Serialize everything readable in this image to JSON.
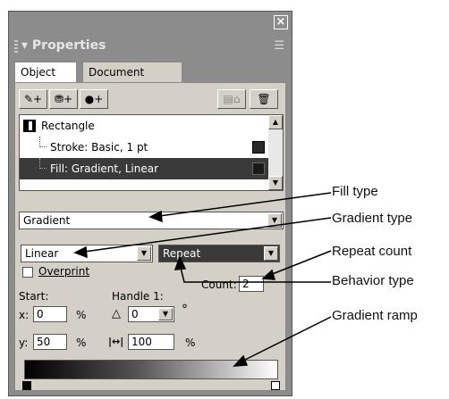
{
  "panel": {
    "close_glyph": "×",
    "title": "▾ Properties",
    "menu_glyph": "☰",
    "tabs": [
      {
        "label": "Object"
      },
      {
        "label": "Document"
      }
    ],
    "toolbar": {
      "pencil_add": "✎+",
      "bucket_add": "⛃+",
      "circle_add": "●+",
      "delete_attr": "▤⌂",
      "trash": "🗑"
    },
    "list": [
      {
        "label": "Rectangle"
      },
      {
        "label": "Stroke: Basic, 1 pt"
      },
      {
        "label": "Fill: Gradient, Linear"
      }
    ],
    "fill_type": "Gradient",
    "gradient_type": "Linear",
    "behavior_type": "Repeat",
    "overprint_label": "Overprint",
    "count_label": "Count:",
    "count_value": "2",
    "start_label": "Start:",
    "handle_label": "Handle 1:",
    "x_label": "x:",
    "x_value": "0",
    "y_label": "y:",
    "y_value": "50",
    "percent": "%",
    "angle_value": "0",
    "degree": "°",
    "length_value": "100"
  },
  "callouts": {
    "fill_type": "Fill type",
    "gradient_type": "Gradient type",
    "repeat_count": "Repeat count",
    "behavior_type": "Behavior type",
    "gradient_ramp": "Gradient ramp"
  },
  "colors": {
    "panel_bg": "#8c8c8c",
    "content_bg": "#d4d0c8",
    "selection": "#3a3a3a"
  }
}
